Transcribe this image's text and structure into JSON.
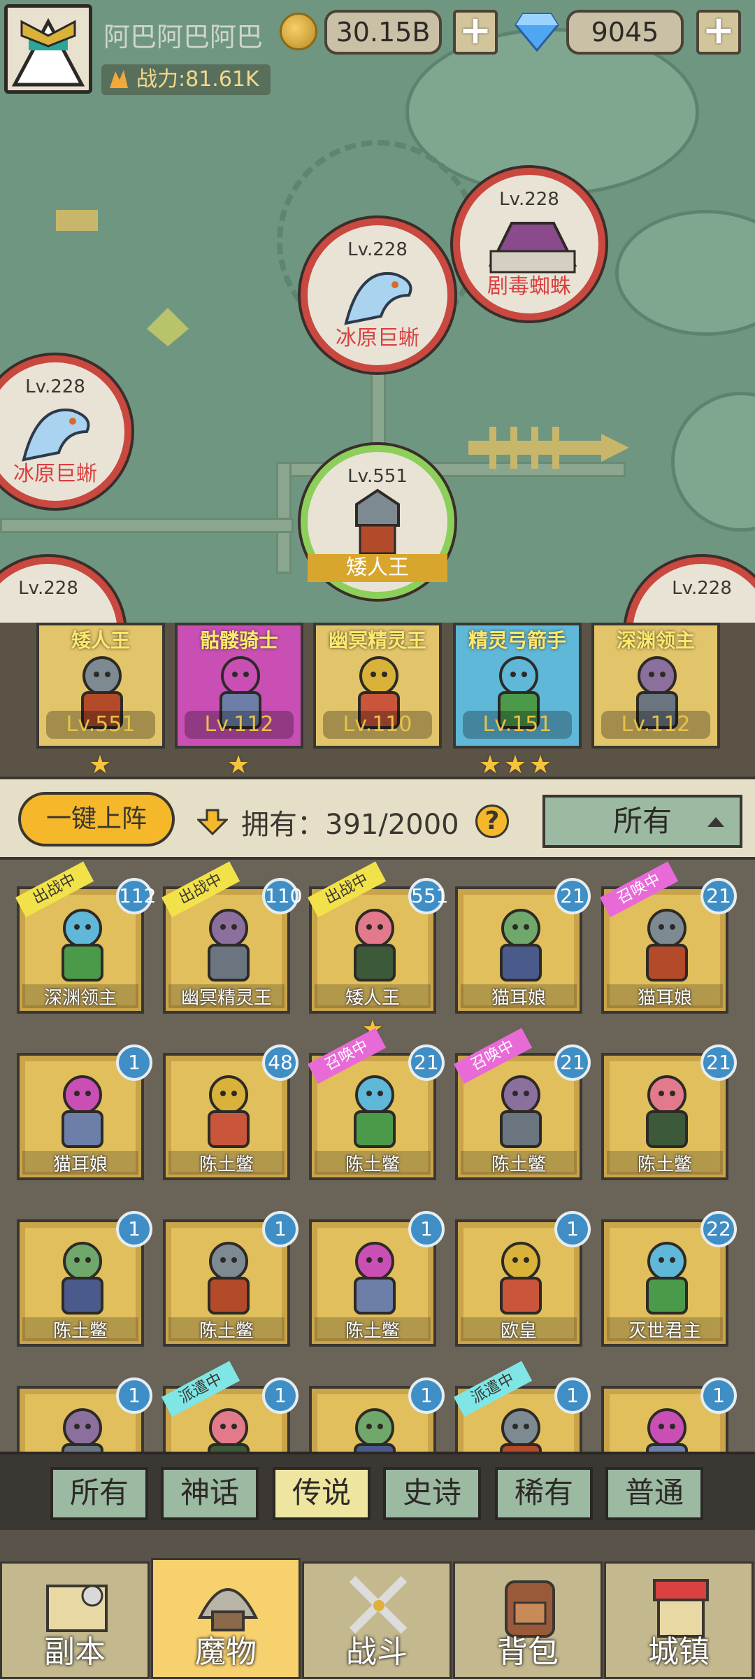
{
  "hud": {
    "player_name": "阿巴阿巴阿巴",
    "power": "战力:81.61K",
    "gold": "30.15B",
    "gems": "9045"
  },
  "map_nodes": [
    {
      "level": "Lv.228",
      "name": "冰原巨蜥",
      "type": "enemy"
    },
    {
      "level": "Lv.228",
      "name": "剧毒蜘蛛",
      "type": "enemy"
    },
    {
      "level": "Lv.228",
      "name": "冰原巨蜥",
      "type": "enemy"
    },
    {
      "level": "Lv.551",
      "name": "矮人王",
      "type": "ally"
    },
    {
      "level": "Lv.228",
      "name": "",
      "type": "enemy"
    },
    {
      "level": "Lv.228",
      "name": "",
      "type": "enemy"
    }
  ],
  "team": [
    {
      "name": "矮人王",
      "level": "Lv.551",
      "stars": 1,
      "color": "#e2c46b"
    },
    {
      "name": "骷髅骑士",
      "level": "Lv.112",
      "stars": 1,
      "color": "#c94fb5"
    },
    {
      "name": "幽冥精灵王",
      "level": "Lv.110",
      "stars": 0,
      "color": "#e2c46b"
    },
    {
      "name": "精灵弓箭手",
      "level": "Lv.151",
      "stars": 3,
      "color": "#5fb8d8"
    },
    {
      "name": "深渊领主",
      "level": "Lv.112",
      "stars": 0,
      "color": "#e2c46b"
    }
  ],
  "toolbar": {
    "auto_deploy": "一键上阵",
    "owned": "拥有：391/2000",
    "help": "?",
    "filter": "所有"
  },
  "cards": [
    {
      "name": "深渊领主",
      "count": "112",
      "tag": "出战中",
      "tagc": "y"
    },
    {
      "name": "幽冥精灵王",
      "count": "110",
      "tag": "出战中",
      "tagc": "y"
    },
    {
      "name": "矮人王",
      "count": "551",
      "tag": "出战中",
      "tagc": "y",
      "star": true
    },
    {
      "name": "猫耳娘",
      "count": "21",
      "tag": "",
      "tagc": ""
    },
    {
      "name": "猫耳娘",
      "count": "21",
      "tag": "召唤中",
      "tagc": "p"
    },
    {
      "name": "猫耳娘",
      "count": "1",
      "tag": "",
      "tagc": ""
    },
    {
      "name": "陈土鳖",
      "count": "48",
      "tag": "",
      "tagc": ""
    },
    {
      "name": "陈土鳖",
      "count": "21",
      "tag": "召唤中",
      "tagc": "p"
    },
    {
      "name": "陈土鳖",
      "count": "21",
      "tag": "召唤中",
      "tagc": "p"
    },
    {
      "name": "陈土鳖",
      "count": "21",
      "tag": "",
      "tagc": ""
    },
    {
      "name": "陈土鳖",
      "count": "1",
      "tag": "",
      "tagc": ""
    },
    {
      "name": "陈土鳖",
      "count": "1",
      "tag": "",
      "tagc": ""
    },
    {
      "name": "陈土鳖",
      "count": "1",
      "tag": "",
      "tagc": ""
    },
    {
      "name": "欧皇",
      "count": "1",
      "tag": "",
      "tagc": ""
    },
    {
      "name": "灭世君主",
      "count": "22",
      "tag": "",
      "tagc": ""
    },
    {
      "name": "",
      "count": "1",
      "tag": "",
      "tagc": ""
    },
    {
      "name": "",
      "count": "1",
      "tag": "派遣中",
      "tagc": "c"
    },
    {
      "name": "",
      "count": "1",
      "tag": "",
      "tagc": ""
    },
    {
      "name": "",
      "count": "1",
      "tag": "派遣中",
      "tagc": "c"
    },
    {
      "name": "",
      "count": "1",
      "tag": "",
      "tagc": ""
    }
  ],
  "rarity": {
    "items": [
      "所有",
      "神话",
      "传说",
      "史诗",
      "稀有",
      "普通"
    ],
    "active": "传说"
  },
  "nav": {
    "items": [
      "副本",
      "魔物",
      "战斗",
      "背包",
      "城镇"
    ],
    "active": "魔物"
  },
  "colors": {
    "accent": "#f4b82a",
    "enemy_ring": "#c9483f",
    "ally_ring": "#8ccf5a",
    "count_badge": "#3f8ec5"
  }
}
